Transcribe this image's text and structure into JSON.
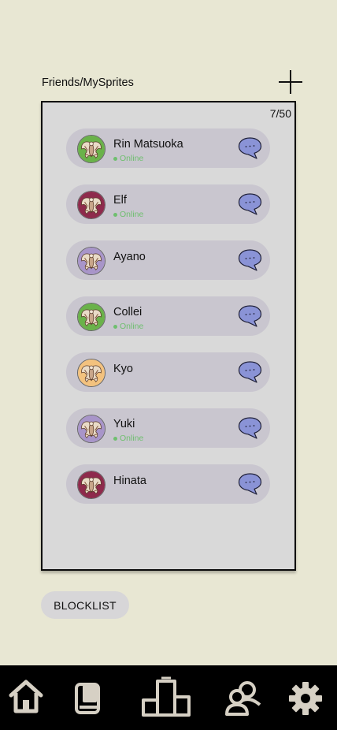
{
  "header": {
    "title": "Friends/MySprites",
    "add_icon": "plus-icon"
  },
  "panel": {
    "count": "7/50"
  },
  "friends": [
    {
      "name": "Rin Matsuoka",
      "status": "Online",
      "avatar_bg": "#6ab24a"
    },
    {
      "name": "Elf",
      "status": "Online",
      "avatar_bg": "#8e2a4c"
    },
    {
      "name": "Ayano",
      "status": "",
      "avatar_bg": "#a895c9"
    },
    {
      "name": "Collei",
      "status": "Online",
      "avatar_bg": "#6ab24a"
    },
    {
      "name": "Kyo",
      "status": "",
      "avatar_bg": "#f3c27e"
    },
    {
      "name": "Yuki",
      "status": "Online",
      "avatar_bg": "#a895c9"
    },
    {
      "name": "Hinata",
      "status": "",
      "avatar_bg": "#8e2a4c"
    }
  ],
  "blocklist_label": "BLOCKLIST",
  "nav": {
    "items": [
      "home-icon",
      "book-icon",
      "leaderboard-icon",
      "friends-icon",
      "settings-icon"
    ],
    "color": "#d6d0c4"
  },
  "colors": {
    "chat_bubble": "#8a93d6",
    "online": "#6fbf6f",
    "row_bg": "#c9c6cf"
  }
}
